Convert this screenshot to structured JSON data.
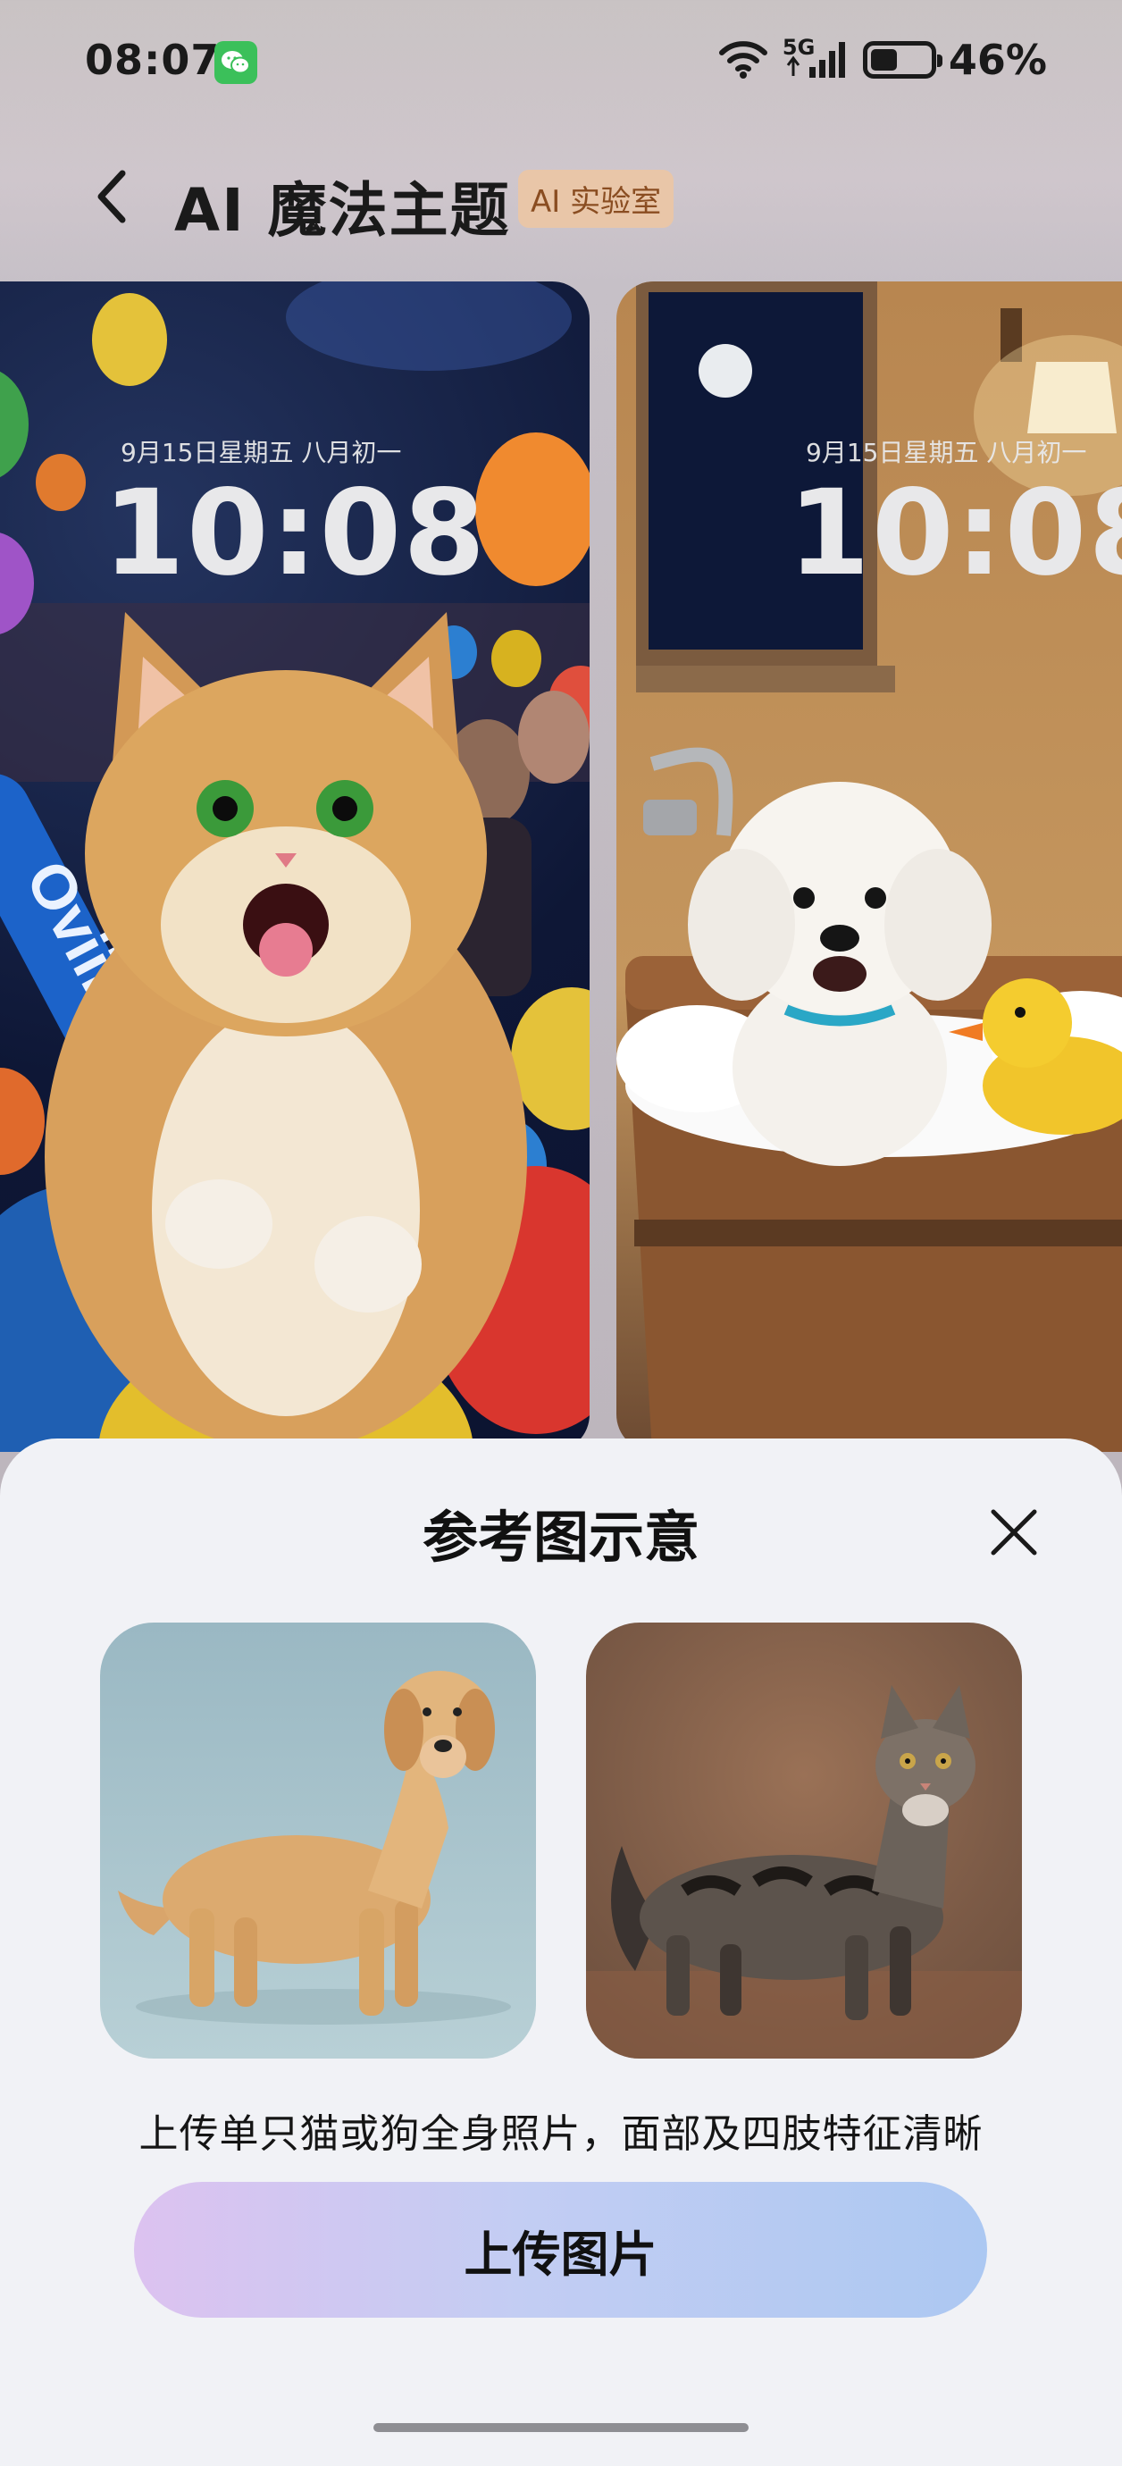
{
  "status_bar": {
    "time": "08:07",
    "network": "5G",
    "battery_percent": "46%",
    "battery_level": 0.46
  },
  "header": {
    "title": "AI 魔法主题",
    "badge": "AI 实验室",
    "back_icon": "chevron-left-icon"
  },
  "wallpapers": [
    {
      "date": "9月15日星期五 八月初一",
      "time": "10:08",
      "bat_text": "Oviin'na"
    },
    {
      "date": "9月15日星期五 八月初一",
      "time": "10:08"
    }
  ],
  "sheet": {
    "title": "参考图示意",
    "close_icon": "close-icon",
    "references": [
      {
        "subject": "dog"
      },
      {
        "subject": "cat"
      }
    ],
    "hint": "上传单只猫或狗全身照片，面部及四肢特征清晰",
    "upload_button": "上传图片"
  }
}
